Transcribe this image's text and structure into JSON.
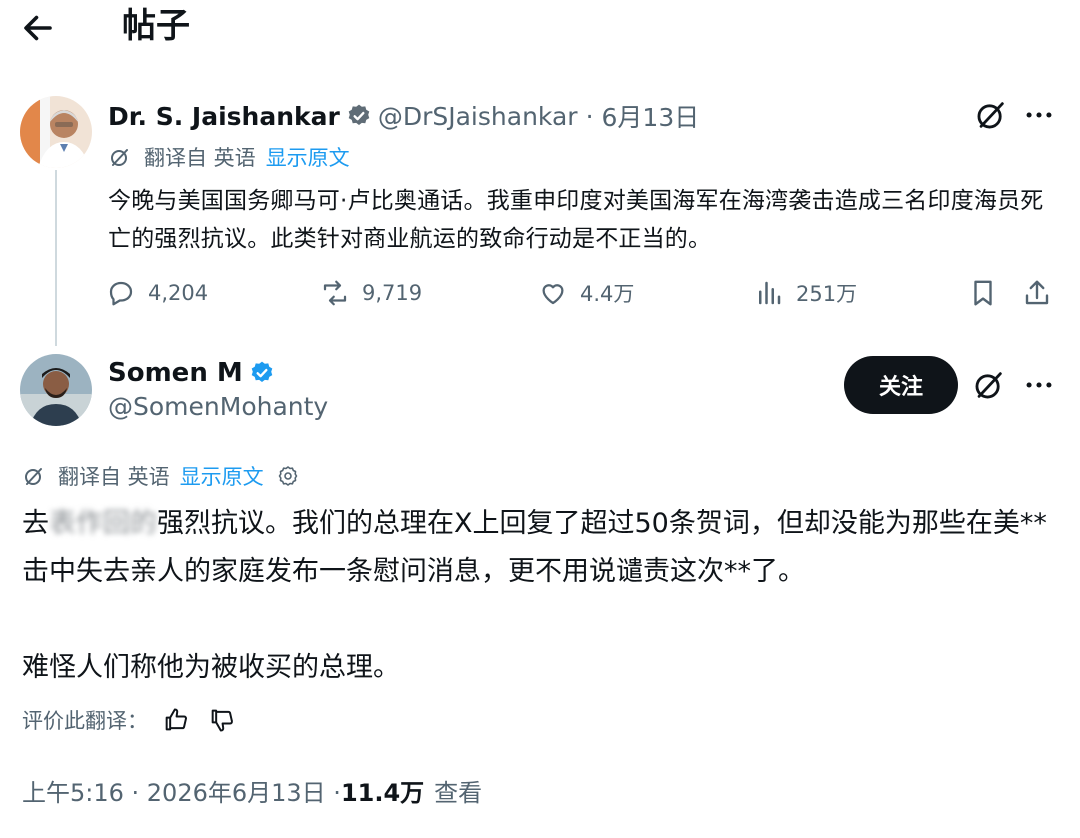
{
  "header": {
    "title": "帖子"
  },
  "tweet1": {
    "name": "Dr. S. Jaishankar",
    "handle": "@DrSJaishankar",
    "date": "6月13日",
    "translated_from": "翻译自 英语",
    "show_original": "显示原文",
    "text": "今晚与美国国务卿马可·卢比奥通话。我重申印度对美国海军在海湾袭击造成三名印度海员死亡的强烈抗议。此类针对商业航运的致命行动是不正当的。",
    "stats": {
      "replies": "4,204",
      "reposts": "9,719",
      "likes": "4.4万",
      "views": "251万"
    }
  },
  "tweet2": {
    "name": "Somen M",
    "handle": "@SomenMohanty",
    "follow_label": "关注",
    "translated_from": "翻译自 英语",
    "show_original": "显示原文",
    "text_blurred": "表作回的",
    "text_p1_rest": "强烈抗议。我们的总理在X上回复了超过50条贺词，但却没能为那些在美**击中失去亲人的家庭发布一条慰问消息，更不用说谴责这次**了。",
    "text_p1_start": "去",
    "text_p2": "难怪人们称他为被收买的总理。",
    "rate_label": "评价此翻译：",
    "time": "上午5:16 · 2026年6月13日 · ",
    "views": "11.4万",
    "views_label": "查看"
  },
  "icons": {
    "back": "arrow-left-icon",
    "grok": "grok-icon",
    "more": "more-icon",
    "verified": "verified-badge-icon",
    "reply": "reply-icon",
    "repost": "repost-icon",
    "like": "heart-icon",
    "views": "views-icon",
    "bookmark": "bookmark-icon",
    "share": "share-icon",
    "translate": "translate-icon",
    "settings": "gear-icon",
    "thumbs_up": "thumbs-up-icon",
    "thumbs_down": "thumbs-down-icon"
  },
  "colors": {
    "accent": "#1d9bf0",
    "text": "#0f1419",
    "muted": "#536471",
    "button": "#0f1419"
  }
}
